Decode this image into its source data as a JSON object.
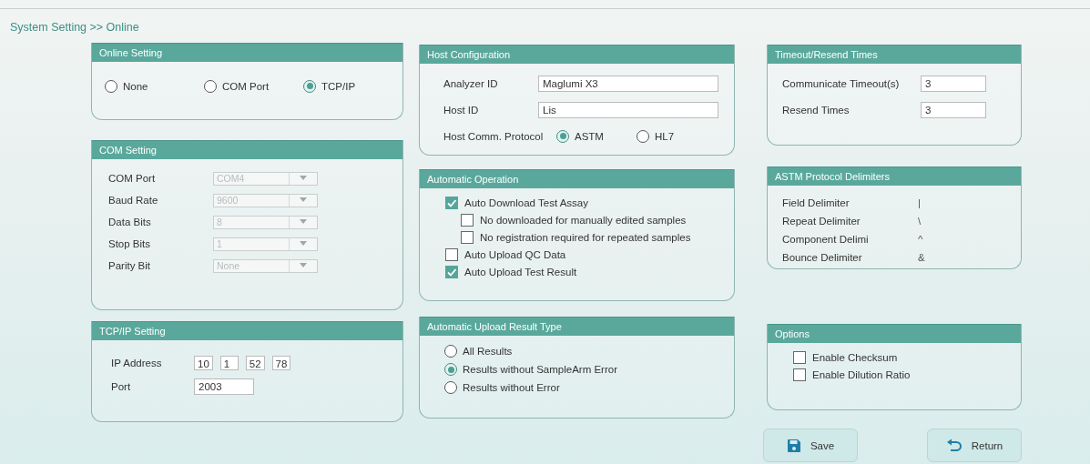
{
  "breadcrumb": "System Setting >> Online",
  "columns": [
    {
      "panels": [
        {
          "title": "Online Setting",
          "kind": "radio_row",
          "options": [
            {
              "label": "None",
              "selected": false
            },
            {
              "label": "COM Port",
              "selected": false
            },
            {
              "label": "TCP/IP",
              "selected": true
            }
          ]
        },
        {
          "title": "COM Setting",
          "kind": "form",
          "rows": [
            {
              "label": "COM Port",
              "kind": "select",
              "value": "COM4",
              "disabled": true
            },
            {
              "label": "Baud Rate",
              "kind": "select",
              "value": "9600",
              "disabled": true
            },
            {
              "label": "Data Bits",
              "kind": "select",
              "value": "8",
              "disabled": true
            },
            {
              "label": "Stop Bits",
              "kind": "select",
              "value": "1",
              "disabled": true
            },
            {
              "label": "Parity Bit",
              "kind": "select",
              "value": "None",
              "disabled": true
            }
          ]
        },
        {
          "title": "TCP/IP Setting",
          "kind": "form",
          "rows": [
            {
              "label": "IP Address",
              "kind": "ip",
              "octets": [
                "10",
                "1",
                "52",
                "78"
              ]
            },
            {
              "label": "Port",
              "kind": "text",
              "value": "2003"
            }
          ]
        }
      ]
    },
    {
      "panels": [
        {
          "title": "Host Configuration",
          "kind": "form",
          "rows": [
            {
              "label": "Analyzer ID",
              "kind": "text",
              "value": "Maglumi X3"
            },
            {
              "label": "Host ID",
              "kind": "text",
              "value": "Lis"
            },
            {
              "label": "Host Comm. Protocol",
              "kind": "radios",
              "options": [
                {
                  "label": "ASTM",
                  "selected": true
                },
                {
                  "label": "HL7",
                  "selected": false
                }
              ]
            }
          ]
        },
        {
          "title": "Automatic Operation",
          "kind": "checks",
          "items": [
            {
              "label": "Auto Download Test Assay",
              "checked": true,
              "children": [
                {
                  "label": "No downloaded for manually edited samples",
                  "checked": false
                },
                {
                  "label": "No registration required for repeated samples",
                  "checked": false
                }
              ]
            },
            {
              "label": "Auto Upload QC Data",
              "checked": false
            },
            {
              "label": "Auto Upload Test Result",
              "checked": true
            }
          ]
        },
        {
          "title": "Automatic Upload Result Type",
          "kind": "radio_list",
          "options": [
            {
              "label": "All Results",
              "selected": false
            },
            {
              "label": "Results without SampleArm Error",
              "selected": true
            },
            {
              "label": "Results without Error",
              "selected": false
            }
          ]
        }
      ]
    },
    {
      "panels": [
        {
          "title": "Timeout/Resend Times",
          "kind": "form",
          "rows": [
            {
              "label": "Communicate Timeout(s)",
              "kind": "text",
              "value": "3"
            },
            {
              "label": "Resend Times",
              "kind": "text",
              "value": "3"
            }
          ]
        },
        {
          "title": "ASTM Protocol Delimiters",
          "kind": "form",
          "rows": [
            {
              "label": "Field Delimiter",
              "kind": "plain",
              "value": "|"
            },
            {
              "label": "Repeat Delimiter",
              "kind": "plain",
              "value": "\\"
            },
            {
              "label": "Component Delimi",
              "kind": "plain",
              "value": "^"
            },
            {
              "label": "Bounce Delimiter",
              "kind": "plain",
              "value": "&"
            }
          ]
        },
        {
          "title": "Options",
          "kind": "checks",
          "items": [
            {
              "label": "Enable Checksum",
              "checked": false
            },
            {
              "label": "Enable Dilution Ratio",
              "checked": false
            }
          ]
        }
      ]
    }
  ],
  "buttons": [
    {
      "label": "Save",
      "kind": "save"
    },
    {
      "label": "Return",
      "kind": "return"
    }
  ]
}
